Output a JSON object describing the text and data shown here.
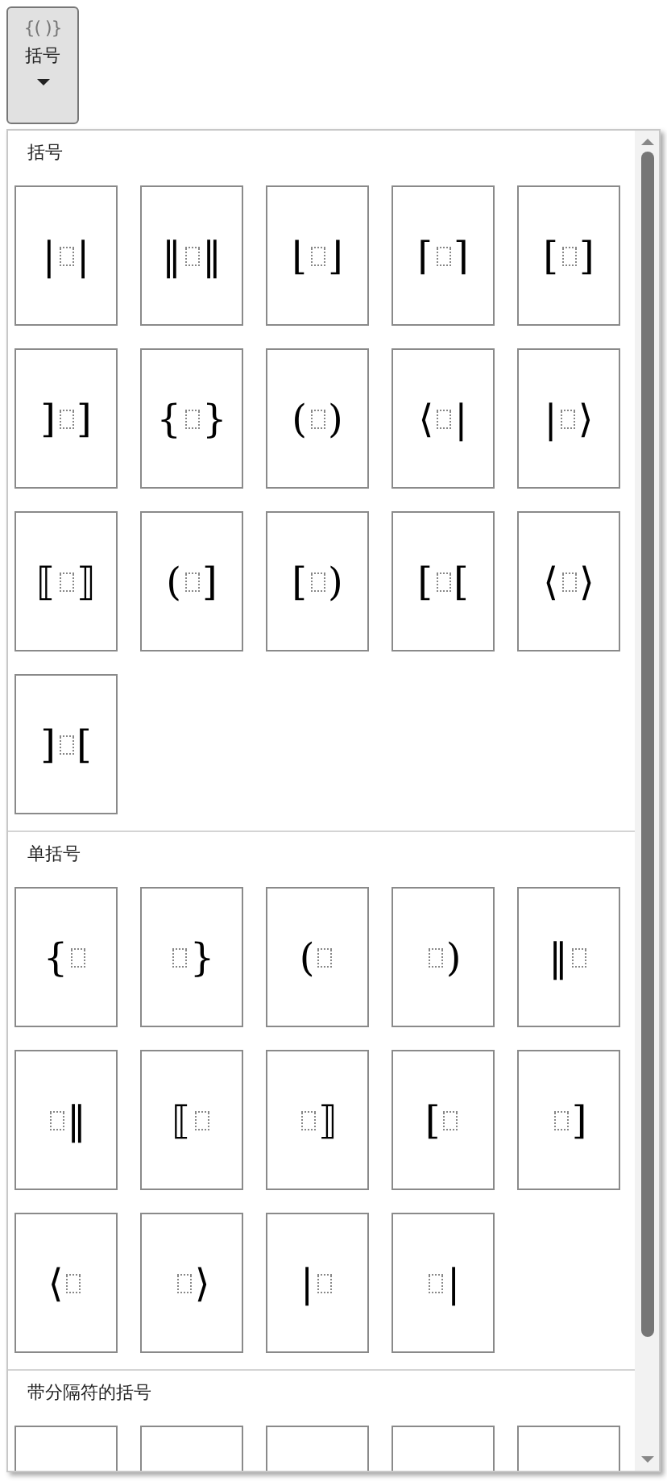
{
  "ribbon_button": {
    "icon_text": "{( )}",
    "label": "括号",
    "expanded": true
  },
  "sections": [
    {
      "title": "括号",
      "items": [
        {
          "kind": "pair",
          "left": "|",
          "right": "|"
        },
        {
          "kind": "pair",
          "left": "‖",
          "right": "‖"
        },
        {
          "kind": "pair",
          "left": "⌊",
          "right": "⌋"
        },
        {
          "kind": "pair",
          "left": "⌈",
          "right": "⌉"
        },
        {
          "kind": "pair",
          "left": "[",
          "right": "]"
        },
        {
          "kind": "pair",
          "left": "]",
          "right": "]"
        },
        {
          "kind": "pair",
          "left": "{",
          "right": "}"
        },
        {
          "kind": "pair",
          "left": "(",
          "right": ")"
        },
        {
          "kind": "pair",
          "left": "⟨",
          "right": "|"
        },
        {
          "kind": "pair",
          "left": "|",
          "right": "⟩"
        },
        {
          "kind": "pair",
          "left": "⟦",
          "right": "⟧"
        },
        {
          "kind": "pair",
          "left": "(",
          "right": "]"
        },
        {
          "kind": "pair",
          "left": "[",
          "right": ")"
        },
        {
          "kind": "pair",
          "left": "[",
          "right": "["
        },
        {
          "kind": "pair",
          "left": "⟨",
          "right": "⟩"
        },
        {
          "kind": "pair",
          "left": "]",
          "right": "["
        }
      ]
    },
    {
      "title": "单括号",
      "items": [
        {
          "kind": "left",
          "left": "{"
        },
        {
          "kind": "right",
          "right": "}"
        },
        {
          "kind": "left",
          "left": "("
        },
        {
          "kind": "right",
          "right": ")"
        },
        {
          "kind": "left",
          "left": "‖"
        },
        {
          "kind": "right",
          "right": "‖"
        },
        {
          "kind": "left",
          "left": "⟦"
        },
        {
          "kind": "right",
          "right": "⟧"
        },
        {
          "kind": "left",
          "left": "["
        },
        {
          "kind": "right",
          "right": "]"
        },
        {
          "kind": "left",
          "left": "⟨"
        },
        {
          "kind": "right",
          "right": "⟩"
        },
        {
          "kind": "left",
          "left": "|"
        },
        {
          "kind": "right",
          "right": "|"
        }
      ]
    },
    {
      "title": "带分隔符的括号",
      "items": [
        {
          "kind": "blank"
        },
        {
          "kind": "blank"
        },
        {
          "kind": "blank"
        },
        {
          "kind": "blank"
        },
        {
          "kind": "blank"
        }
      ]
    }
  ]
}
